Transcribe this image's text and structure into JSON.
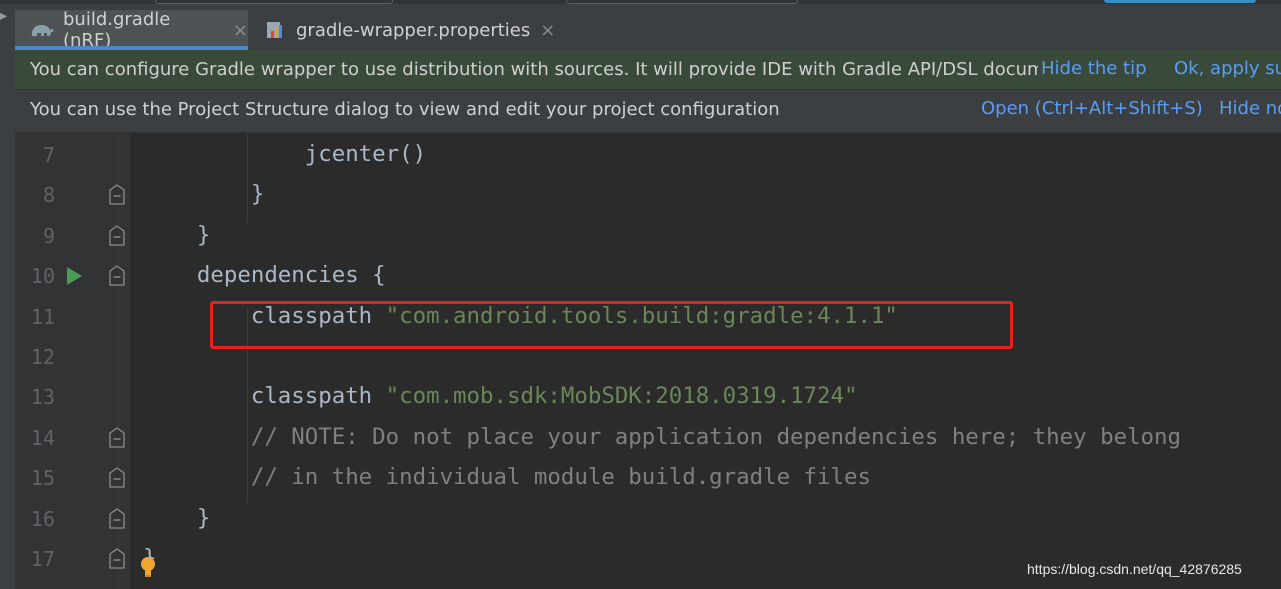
{
  "tabs": [
    {
      "label": "build.gradle (nRF)",
      "icon": "gradle-elephant-icon",
      "active": true,
      "close": "×"
    },
    {
      "label": "gradle-wrapper.properties",
      "icon": "properties-file-icon",
      "active": false,
      "close": "×"
    }
  ],
  "notifications": {
    "wrapper_tip": {
      "message": "You can configure Gradle wrapper to use distribution with sources. It will provide IDE with Gradle API/DSL documentation",
      "hide_label": "Hide the tip",
      "ok_label": "Ok, apply suggestion!"
    },
    "project_structure": {
      "message": "You can use the Project Structure dialog to view and edit your project configuration",
      "open_label": "Open (Ctrl+Alt+Shift+S)",
      "hide_label": "Hide notification"
    }
  },
  "editor": {
    "lines": [
      {
        "num": "7",
        "indent": "            ",
        "parts": [
          {
            "t": "jcenter()",
            "c": "plain"
          }
        ]
      },
      {
        "num": "8",
        "indent": "        ",
        "parts": [
          {
            "t": "}",
            "c": "plain"
          }
        ]
      },
      {
        "num": "9",
        "indent": "    ",
        "parts": [
          {
            "t": "}",
            "c": "plain"
          }
        ]
      },
      {
        "num": "10",
        "indent": "    ",
        "parts": [
          {
            "t": "dependencies {",
            "c": "plain"
          }
        ]
      },
      {
        "num": "11",
        "indent": "        ",
        "parts": [
          {
            "t": "classpath ",
            "c": "plain"
          },
          {
            "t": "\"com.android.tools.build:gradle:4.1.1\"",
            "c": "str"
          }
        ]
      },
      {
        "num": "12",
        "indent": "",
        "parts": []
      },
      {
        "num": "13",
        "indent": "        ",
        "parts": [
          {
            "t": "classpath ",
            "c": "plain"
          },
          {
            "t": "\"com.mob.sdk:MobSDK:2018.0319.1724\"",
            "c": "str"
          }
        ]
      },
      {
        "num": "14",
        "indent": "        ",
        "parts": [
          {
            "t": "// NOTE: Do not place your application dependencies here; they belong",
            "c": "cmt"
          }
        ]
      },
      {
        "num": "15",
        "indent": "        ",
        "parts": [
          {
            "t": "// in the individual module build.gradle files",
            "c": "cmt"
          }
        ]
      },
      {
        "num": "16",
        "indent": "    ",
        "parts": [
          {
            "t": "}",
            "c": "plain"
          }
        ]
      },
      {
        "num": "17",
        "indent": "",
        "parts": [
          {
            "t": "}",
            "c": "plain"
          }
        ]
      }
    ],
    "fold_markers": [
      "8",
      "9",
      "10",
      "14",
      "15",
      "16",
      "17"
    ],
    "run_marker_line": "10",
    "highlighted_line": "11"
  },
  "watermark": "https://blog.csdn.net/qq_42876285",
  "colors": {
    "background": "#2b2b2b",
    "keyword_text": "#a9b7c6",
    "string": "#6a8759",
    "comment": "#808080",
    "link": "#589df6",
    "highlight_box": "#e8211e",
    "run_arrow": "#499c54"
  }
}
